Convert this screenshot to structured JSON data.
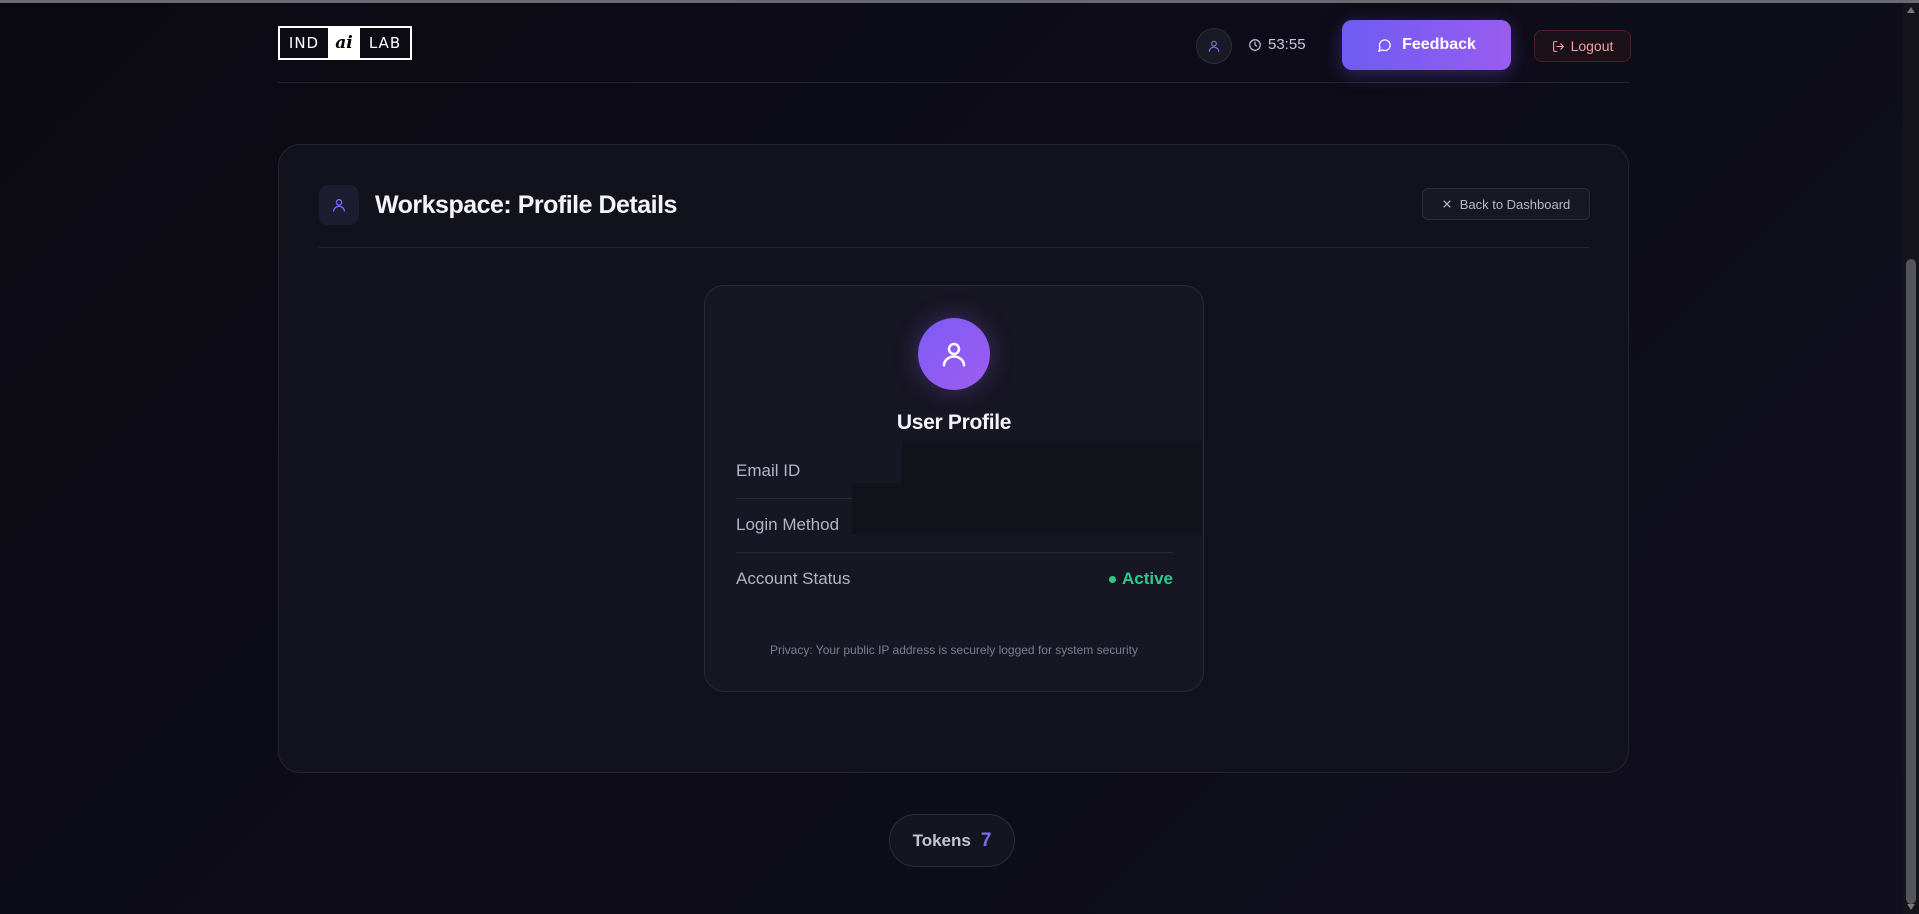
{
  "header": {
    "logo": {
      "left": "IND",
      "middle": "ai",
      "right": "LAB"
    },
    "timer": "53:55",
    "feedback_label": "Feedback",
    "logout_label": "Logout"
  },
  "panel": {
    "title": "Workspace: Profile Details",
    "back_label": "Back to Dashboard"
  },
  "profile": {
    "title": "User Profile",
    "email_label": "Email ID",
    "login_label": "Login Method",
    "status_label": "Account Status",
    "status_value": "Active",
    "privacy_note": "Privacy: Your public IP address is securely logged for system security"
  },
  "tokens": {
    "label": "Tokens",
    "value": "7"
  },
  "colors": {
    "accent": "#7b6cf6",
    "feedback_gradient_start": "#6e5cf3",
    "feedback_gradient_end": "#9a5cf0",
    "status_active": "#2ec98e",
    "logout_text": "#f0a0a8"
  },
  "icons": {
    "nav_user": "user-icon",
    "timer": "clock-icon",
    "feedback": "message-circle-icon",
    "logout": "logout-icon",
    "panel_head": "user-icon",
    "back": "close-icon",
    "avatar": "user-icon"
  }
}
